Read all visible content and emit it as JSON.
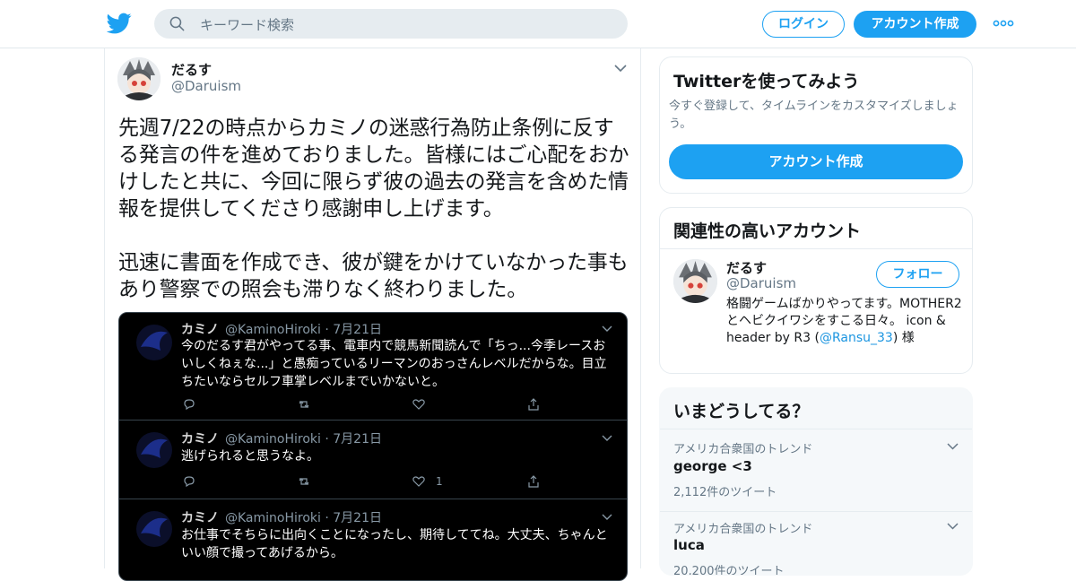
{
  "header": {
    "search_placeholder": "キーワード検索",
    "login_label": "ログイン",
    "signup_label": "アカウント作成"
  },
  "tweet": {
    "display_name": "だるす",
    "handle": "@Daruism",
    "text": "先週7/22の時点からカミノの迷惑行為防止条例に反する発言の件を進めておりました。皆様にはご心配をおかけしたと共に、今回に限らず彼の過去の発言を含めた情報を提供してくださり感謝申し上げます。\n\n迅速に書面を作成でき、彼が鍵をかけていなかった事もあり警察での照会も滞りなく終わりました。"
  },
  "screenshot": {
    "rows": [
      {
        "name": "カミノ",
        "meta": "@KaminoHiroki · 7月21日",
        "text": "今のだるす君がやってる事、電車内で競馬新聞読んで「ちっ...今季レースおいしくねぇな...」と愚痴っているリーマンのおっさんレベルだからな。目立ちたいならセルフ車掌レベルまでいかないと。",
        "like_count": ""
      },
      {
        "name": "カミノ",
        "meta": "@KaminoHiroki · 7月21日",
        "text": "逃げられると思うなよ。",
        "like_count": "1"
      },
      {
        "name": "カミノ",
        "meta": "@KaminoHiroki · 7月21日",
        "text": "お仕事でそちらに出向くことになったし、期待しててね。大丈夫、ちゃんといい顔で撮ってあげるから。",
        "like_count": ""
      }
    ]
  },
  "sidebar": {
    "signup_card": {
      "title": "Twitterを使ってみよう",
      "desc": "今すぐ登録して、タイムラインをカスタマイズしましょう。",
      "button": "アカウント作成"
    },
    "related": {
      "title": "関連性の高いアカウント",
      "name": "だるす",
      "handle": "@Daruism",
      "follow_label": "フォロー",
      "bio_pre": "格闘ゲームばかりやってます。MOTHER2とヘビクイワシをすこる日々。 icon & header by R3 (",
      "bio_link": "@Ransu_33",
      "bio_post": ") 様"
    },
    "trends": {
      "title": "いまどうしてる？",
      "items": [
        {
          "context": "アメリカ合衆国のトレンド",
          "name": "george <3",
          "count": "2,112件のツイート"
        },
        {
          "context": "アメリカ合衆国のトレンド",
          "name": "luca",
          "count": "20,200件のツイート"
        }
      ]
    }
  },
  "colors": {
    "brand_blue": "#1da1f2",
    "dark_bg": "#000000"
  },
  "icons": [
    "twitter-bird-icon",
    "search-icon",
    "more-icon",
    "chevron-down-icon",
    "reply-icon",
    "retweet-icon",
    "like-icon",
    "share-icon"
  ]
}
